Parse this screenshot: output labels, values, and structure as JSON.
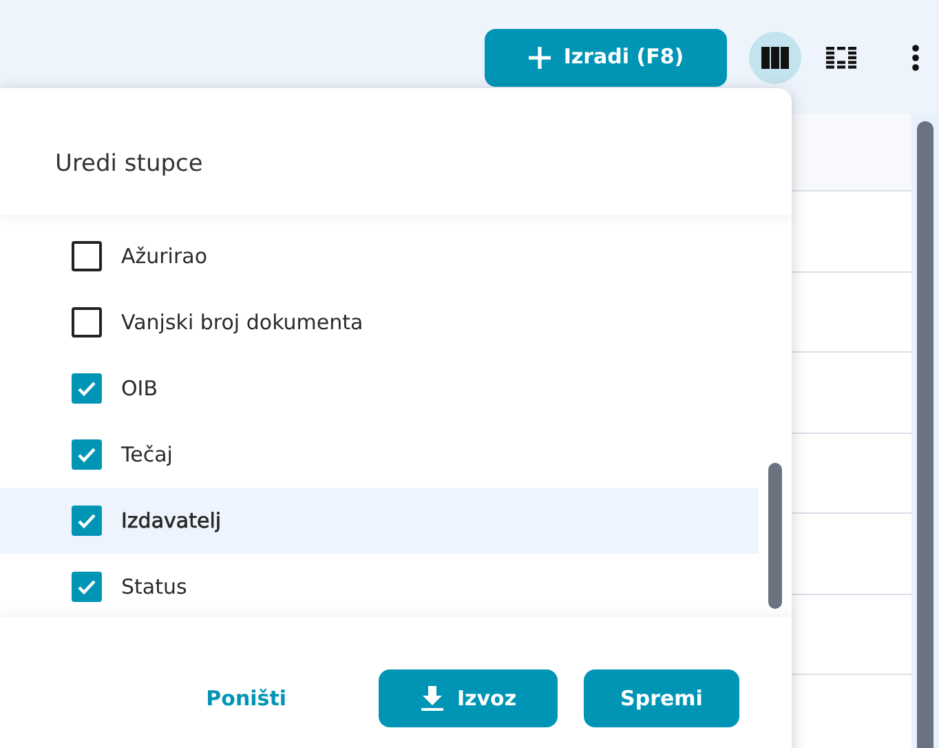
{
  "toolbar": {
    "create_button": "Izradi (F8)",
    "view_toggles": [
      {
        "kind": "columns",
        "selected": true
      },
      {
        "kind": "grid",
        "selected": false
      }
    ]
  },
  "table": {
    "rows": [
      {
        "kind": "header"
      },
      {
        "kind": "row"
      },
      {
        "kind": "row"
      },
      {
        "kind": "row"
      },
      {
        "kind": "row"
      },
      {
        "kind": "row"
      },
      {
        "kind": "row"
      }
    ]
  },
  "dialog": {
    "title": "Uredi stupce",
    "columns": [
      {
        "label": "Ažurirao",
        "checked": false,
        "selected": false
      },
      {
        "label": "Vanjski broj dokumenta",
        "checked": false,
        "selected": false
      },
      {
        "label": "OIB",
        "checked": true,
        "selected": false
      },
      {
        "label": "Tečaj",
        "checked": true,
        "selected": false
      },
      {
        "label": "Izdavatelj",
        "checked": true,
        "selected": true
      },
      {
        "label": "Status",
        "checked": true,
        "selected": false
      }
    ],
    "cancel": "Poništi",
    "export": "Izvoz",
    "save": "Spremi"
  }
}
